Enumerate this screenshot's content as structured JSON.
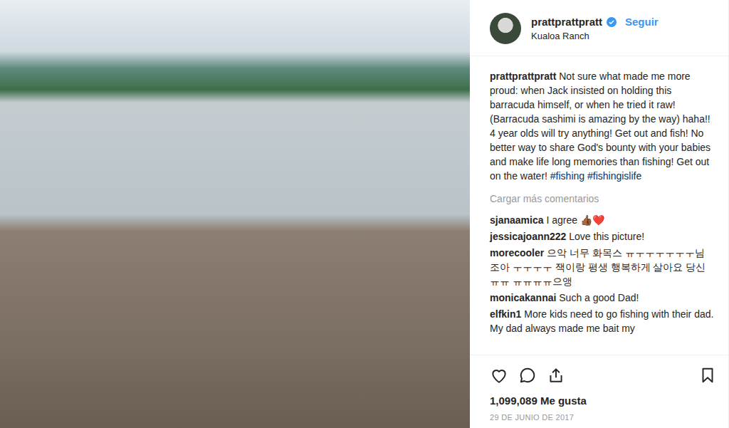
{
  "post": {
    "author": {
      "username": "prattprattpratt",
      "verified": true,
      "follow": "Seguir",
      "location": "Kualoa Ranch"
    },
    "caption": {
      "username": "prattprattpratt",
      "text": "Not sure what made me more proud: when Jack insisted on holding this barracuda himself, or when he tried it raw! (Barracuda sashimi is amazing by the way) haha!! 4 year olds will try anything! Get out and fish! No better way to share God's bounty with your babies and make life long memories than fishing! Get out on the water!",
      "hashtags": [
        "#fishing",
        "#fishingislife"
      ]
    },
    "load_more": "Cargar más comentarios",
    "comments": [
      {
        "username": "sjanaamica",
        "text": "I agree 👍🏾❤️"
      },
      {
        "username": "jessicajoann222",
        "text": "Love this picture!"
      },
      {
        "username": "morecooler",
        "text": "으악 너무 화목스 ㅠㅜㅜㅜㅜㅜㅜ님 조아 ㅜㅜㅜㅜ 잭이랑 평생 행복하게 살아요 당신 ㅠㅠ ㅠㅠㅠㅠ으앵"
      },
      {
        "username": "monicakannai",
        "text": "Such a good Dad!"
      },
      {
        "username": "elfkin1",
        "text": "More kids need to go fishing with their dad. My dad always made me bait my"
      }
    ],
    "actions": {
      "liked": false,
      "saved": false
    },
    "likes": "1,099,089 Me gusta",
    "date": "29 DE JUNIO DE 2017"
  }
}
